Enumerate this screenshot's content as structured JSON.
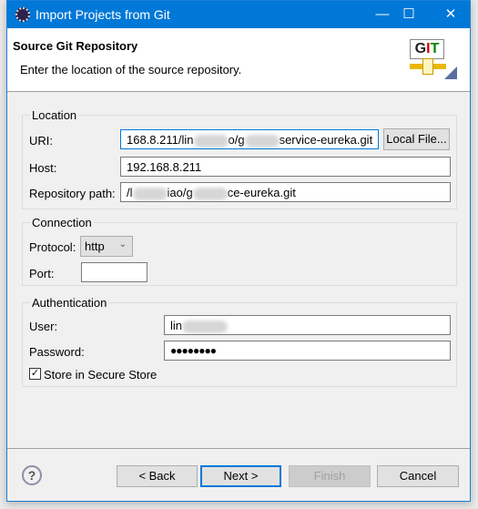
{
  "window": {
    "title": "Import Projects from Git",
    "minimize": "—",
    "maximize": "☐",
    "close": "✕"
  },
  "header": {
    "title": "Source Git Repository",
    "description": "Enter the location of the source repository.",
    "logo_text": "GIT"
  },
  "location": {
    "legend": "Location",
    "uri_label": "URI:",
    "uri_value_parts": [
      "168.8.211/lin",
      "o/g",
      "service-eureka.git"
    ],
    "local_file_button": "Local File...",
    "host_label": "Host:",
    "host_value": "192.168.8.211",
    "repo_path_label": "Repository path:",
    "repo_path_parts": [
      "/l",
      "iao/g",
      "ce-eureka.git"
    ]
  },
  "connection": {
    "legend": "Connection",
    "protocol_label": "Protocol:",
    "protocol_value": "http",
    "port_label": "Port:",
    "port_value": ""
  },
  "authentication": {
    "legend": "Authentication",
    "user_label": "User:",
    "user_value": "lin",
    "password_label": "Password:",
    "password_value": "●●●●●●●●",
    "store_label": "Store in Secure Store",
    "store_checked": true
  },
  "buttons": {
    "help": "?",
    "back": "< Back",
    "next": "Next >",
    "finish": "Finish",
    "cancel": "Cancel"
  },
  "colors": {
    "titlebar": "#0078d7",
    "focus": "#0078d7"
  }
}
